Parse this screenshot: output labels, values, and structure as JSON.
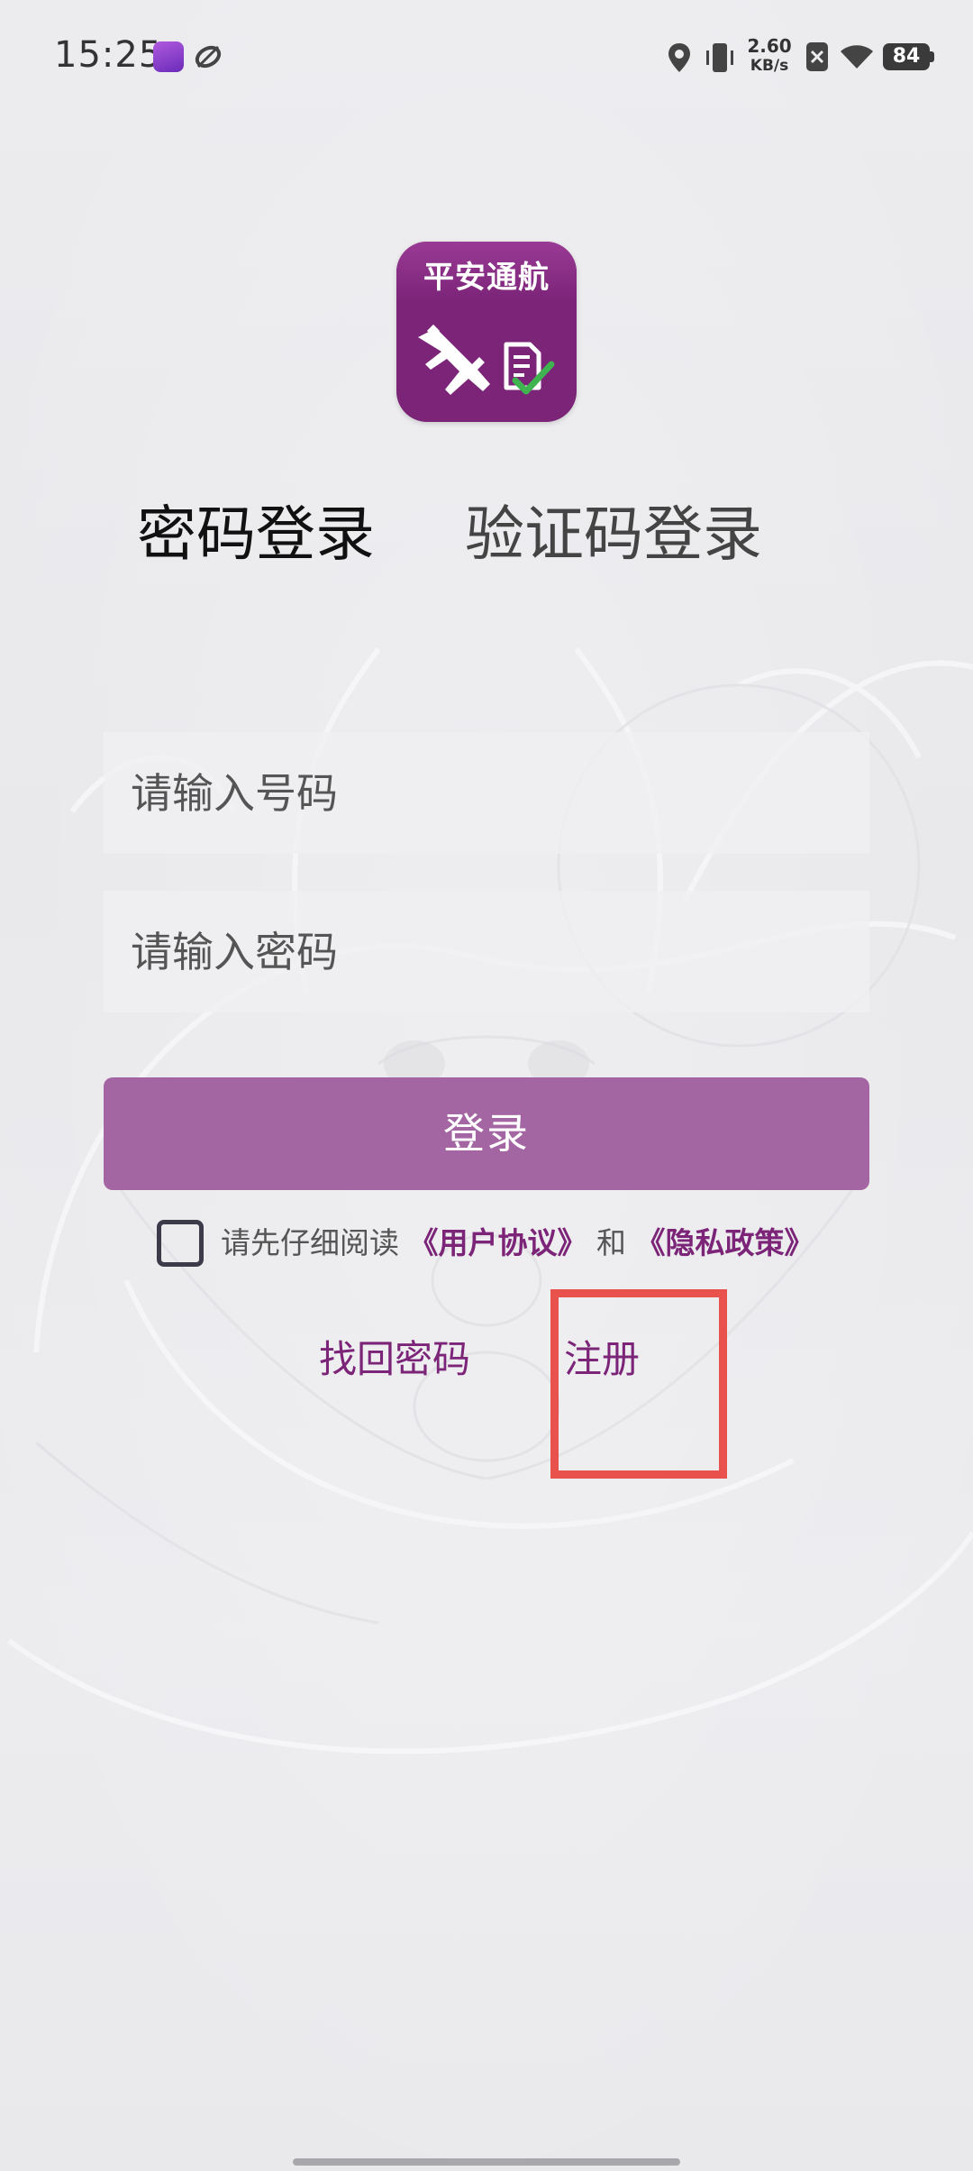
{
  "status_bar": {
    "time": "15:25",
    "net_speed_value": "2.60",
    "net_speed_unit": "KB/s",
    "battery": "84",
    "icons": [
      "app-notification-icon",
      "loop-icon",
      "location-icon",
      "vibrate-icon",
      "sim-off-icon",
      "wifi-icon",
      "battery-icon"
    ]
  },
  "app": {
    "logo_text": "平安通航",
    "logo_icons": [
      "airplane-icon",
      "document-check-icon"
    ],
    "brand_color": "#7b2478"
  },
  "tabs": {
    "password_login": "密码登录",
    "code_login": "验证码登录",
    "active": "password_login"
  },
  "form": {
    "phone_placeholder": "请输入号码",
    "phone_value": "",
    "password_placeholder": "请输入密码",
    "password_value": "",
    "login_button": "登录",
    "login_button_color": "#a466a3"
  },
  "agreement": {
    "checked": false,
    "prefix": "请先仔细阅读",
    "user_agreement": "《用户协议》",
    "connector": "和",
    "privacy_policy": "《隐私政策》"
  },
  "links": {
    "forgot_password": "找回密码",
    "register": "注册"
  },
  "highlight_color": "#e8514c"
}
